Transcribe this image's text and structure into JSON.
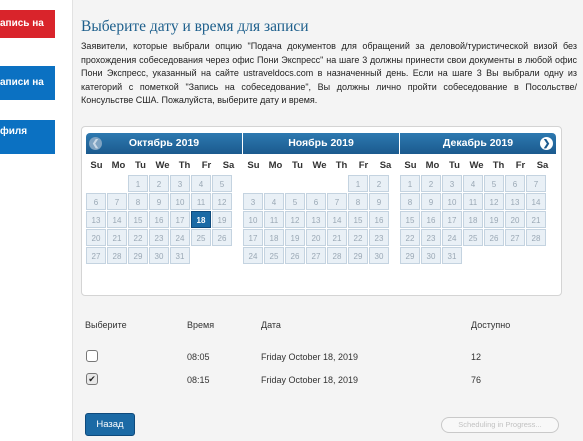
{
  "sidebar": {
    "item1": "апись на",
    "item2": "аписи на",
    "item3": "филя"
  },
  "main": {
    "title": "Выберите дату и время для записи",
    "intro": "Заявители, которые выбрали опцию \"Подача документов для обращений за деловой/туристической визой без прохождения собеседования через офис Пони Экспресс\" на шаге 3 должны принести свои документы в любой офис Пони Экспресс, указанный на сайте ustraveldocs.com в назначенный день. Если на шаге 3 Вы выбрали одну из категорий с пометкой \"Запись на собеседование\", Вы должны лично пройти собеседование в Посольстве/Консульстве США. Пожалуйста, выберите дату и время."
  },
  "calendar": {
    "weekdays": [
      "Su",
      "Mo",
      "Tu",
      "We",
      "Th",
      "Fr",
      "Sa"
    ],
    "months": [
      {
        "title": "Октябрь 2019",
        "lead": 2,
        "days": 31,
        "selected": 18
      },
      {
        "title": "Ноябрь 2019",
        "lead": 5,
        "days": 30,
        "selected": null
      },
      {
        "title": "Декабрь 2019",
        "lead": 0,
        "days": 31,
        "selected": null
      }
    ],
    "prev_icon": "❮",
    "next_icon": "❯"
  },
  "table": {
    "headers": {
      "select": "Выберите",
      "time": "Время",
      "date": "Дата",
      "available": "Доступно"
    },
    "rows": [
      {
        "checked": false,
        "time": "08:05",
        "date": "Friday October 18, 2019",
        "available": "12"
      },
      {
        "checked": true,
        "time": "08:15",
        "date": "Friday October 18, 2019",
        "available": "76"
      }
    ]
  },
  "buttons": {
    "back": "Назад",
    "scheduling": "Scheduling in Progress..."
  },
  "colors": {
    "brand_blue": "#0b71c2",
    "brand_red": "#d9242b",
    "calendar_header": "#1b5a8e",
    "selected_day": "#1b6aa5"
  }
}
